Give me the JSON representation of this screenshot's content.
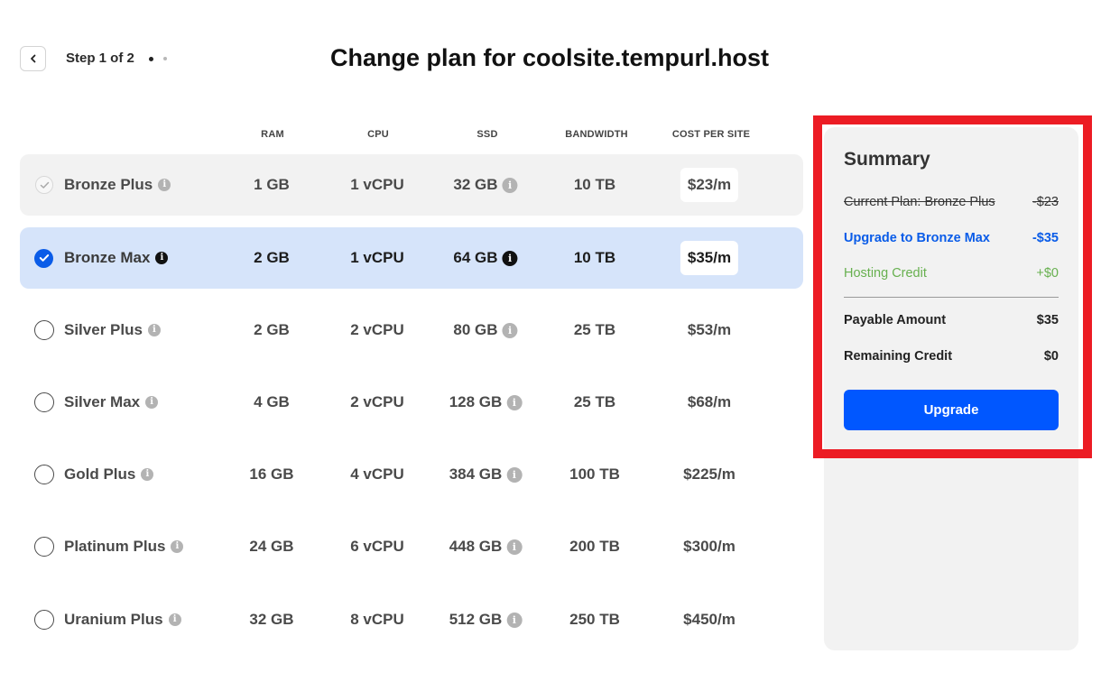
{
  "header": {
    "step_text": "Step 1 of 2",
    "title": "Change plan for coolsite.tempurl.host"
  },
  "table": {
    "columns": {
      "ram": "RAM",
      "cpu": "CPU",
      "ssd": "SSD",
      "bandwidth": "BANDWIDTH",
      "cost": "COST PER SITE"
    },
    "plans": [
      {
        "name": "Bronze Plus",
        "ram": "1 GB",
        "cpu": "1 vCPU",
        "ssd": "32 GB",
        "bandwidth": "10 TB",
        "cost": "$23/m",
        "state": "current"
      },
      {
        "name": "Bronze Max",
        "ram": "2 GB",
        "cpu": "1 vCPU",
        "ssd": "64 GB",
        "bandwidth": "10 TB",
        "cost": "$35/m",
        "state": "selected"
      },
      {
        "name": "Silver Plus",
        "ram": "2 GB",
        "cpu": "2 vCPU",
        "ssd": "80 GB",
        "bandwidth": "25 TB",
        "cost": "$53/m",
        "state": "available"
      },
      {
        "name": "Silver Max",
        "ram": "4 GB",
        "cpu": "2 vCPU",
        "ssd": "128 GB",
        "bandwidth": "25 TB",
        "cost": "$68/m",
        "state": "available"
      },
      {
        "name": "Gold Plus",
        "ram": "16 GB",
        "cpu": "4 vCPU",
        "ssd": "384 GB",
        "bandwidth": "100 TB",
        "cost": "$225/m",
        "state": "available"
      },
      {
        "name": "Platinum Plus",
        "ram": "24 GB",
        "cpu": "6 vCPU",
        "ssd": "448 GB",
        "bandwidth": "200 TB",
        "cost": "$300/m",
        "state": "available"
      },
      {
        "name": "Uranium Plus",
        "ram": "32 GB",
        "cpu": "8 vCPU",
        "ssd": "512 GB",
        "bandwidth": "250 TB",
        "cost": "$450/m",
        "state": "available"
      }
    ]
  },
  "summary": {
    "title": "Summary",
    "current_label": "Current Plan: Bronze Plus",
    "current_value": "-$23",
    "upgrade_label": "Upgrade to Bronze Max",
    "upgrade_value": "-$35",
    "credit_label": "Hosting Credit",
    "credit_value": "+$0",
    "payable_label": "Payable Amount",
    "payable_value": "$35",
    "remaining_label": "Remaining Credit",
    "remaining_value": "$0",
    "button_label": "Upgrade"
  },
  "icons": {
    "back": "chevron-left-icon",
    "info": "info-icon",
    "check": "check-icon"
  },
  "colors": {
    "accent": "#0057ff",
    "selected_row": "#d6e4fa",
    "current_row": "#f2f2f2",
    "credit_green": "#67b04f",
    "highlight_red": "#ec1c24"
  }
}
